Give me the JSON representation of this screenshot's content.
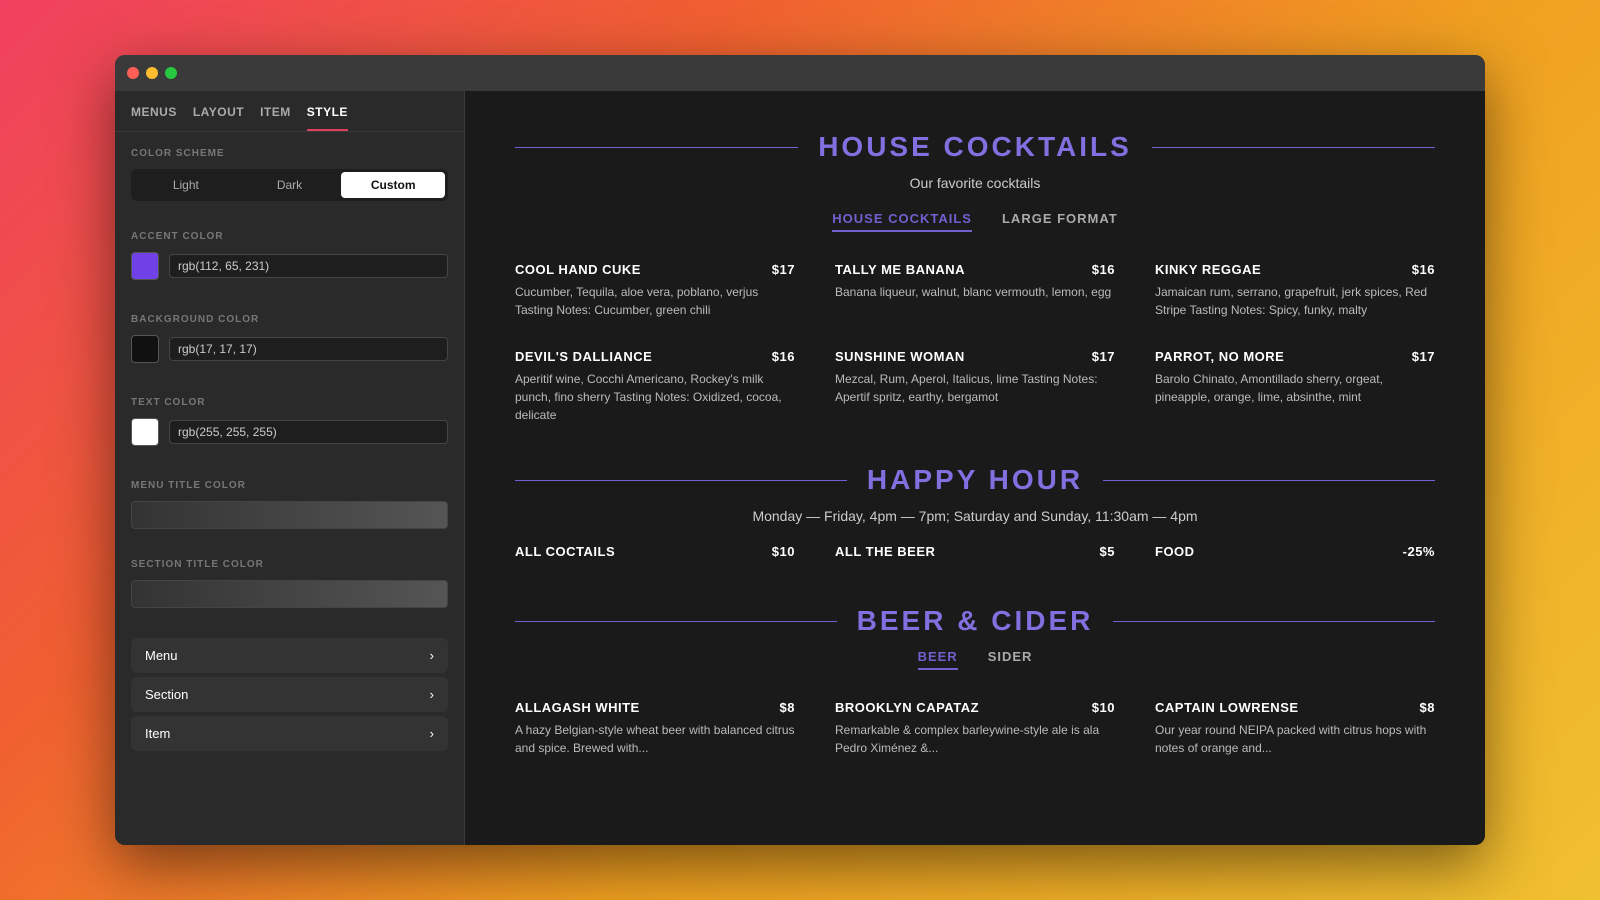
{
  "window": {
    "traffic_lights": [
      "red",
      "yellow",
      "green"
    ]
  },
  "sidebar": {
    "nav_tabs": [
      {
        "label": "MENUS",
        "active": false
      },
      {
        "label": "LAYOUT",
        "active": false
      },
      {
        "label": "ITEM",
        "active": false
      },
      {
        "label": "STYLE",
        "active": true
      }
    ],
    "color_scheme": {
      "label": "COLOR SCHEME",
      "options": [
        {
          "label": "Light",
          "active": false
        },
        {
          "label": "Dark",
          "active": false
        },
        {
          "label": "Custom",
          "active": true
        }
      ]
    },
    "accent_color": {
      "label": "ACCENT COLOR",
      "swatch": "rgb(112,65,231)",
      "value": "rgb(112, 65, 231)"
    },
    "background_color": {
      "label": "BACKGROUND COLOR",
      "swatch": "rgb(17,17,17)",
      "value": "rgb(17, 17, 17)"
    },
    "text_color": {
      "label": "TEXT COLOR",
      "swatch": "rgb(255,255,255)",
      "value": "rgb(255, 255, 255)"
    },
    "menu_title_color": {
      "label": "MENU TITLE COLOR"
    },
    "section_title_color": {
      "label": "SECTION TITLE COLOR"
    },
    "nav_items": [
      {
        "label": "Menu"
      },
      {
        "label": "Section"
      },
      {
        "label": "Item"
      }
    ]
  },
  "main": {
    "sections": [
      {
        "title": "HOUSE COCKTAILS",
        "subtitle": "Our favorite cocktails",
        "tabs": [
          {
            "label": "HOUSE COCKTAILS",
            "active": true
          },
          {
            "label": "LARGE FORMAT",
            "active": false
          }
        ],
        "items": [
          {
            "name": "COOL HAND CUKE",
            "price": "$17",
            "description": "Cucumber, Tequila, aloe vera, poblano, verjus\nTasting Notes: Cucumber, green chili"
          },
          {
            "name": "TALLY ME BANANA",
            "price": "$16",
            "description": "Banana liqueur, walnut, blanc vermouth, lemon, egg"
          },
          {
            "name": "KINKY REGGAE",
            "price": "$16",
            "description": "Jamaican rum, serrano, grapefruit, jerk spices, Red Stripe\nTasting Notes: Spicy, funky, malty"
          },
          {
            "name": "DEVIL'S DALLIANCE",
            "price": "$16",
            "description": "Aperitif wine, Cocchi Americano, Rockey's milk punch, fino sherry\nTasting Notes: Oxidized, cocoa, delicate"
          },
          {
            "name": "SUNSHINE WOMAN",
            "price": "$17",
            "description": "Mezcal, Rum, Aperol, Italicus, lime\nTasting Notes: Apertif spritz, earthy, bergamot"
          },
          {
            "name": "PARROT, NO MORE",
            "price": "$17",
            "description": "Barolo Chinato, Amontillado sherry, orgeat, pineapple, orange, lime, absinthe, mint"
          }
        ]
      },
      {
        "title": "HAPPY HOUR",
        "subtitle": "Monday — Friday, 4pm — 7pm; Saturday and Sunday, 11:30am — 4pm",
        "tabs": [],
        "items": [
          {
            "name": "ALL COCTAILS",
            "price": "$10",
            "description": ""
          },
          {
            "name": "ALL THE BEER",
            "price": "$5",
            "description": ""
          },
          {
            "name": "FOOD",
            "price": "-25%",
            "description": ""
          }
        ]
      },
      {
        "title": "BEER & CIDER",
        "subtitle": "",
        "tabs": [
          {
            "label": "BEER",
            "active": true
          },
          {
            "label": "SIDER",
            "active": false
          }
        ],
        "items": [
          {
            "name": "ALLAGASH WHITE",
            "price": "$8",
            "description": "A hazy Belgian-style wheat beer with balanced citrus and spice. Brewed with..."
          },
          {
            "name": "BROOKLYN CAPATAZ",
            "price": "$10",
            "description": "Remarkable & complex barleywine-style ale is ala Pedro Ximénez &..."
          },
          {
            "name": "CAPTAIN LOWRENSE",
            "price": "$8",
            "description": "Our year round NEIPA packed with citrus hops with notes of orange and..."
          }
        ]
      }
    ]
  }
}
